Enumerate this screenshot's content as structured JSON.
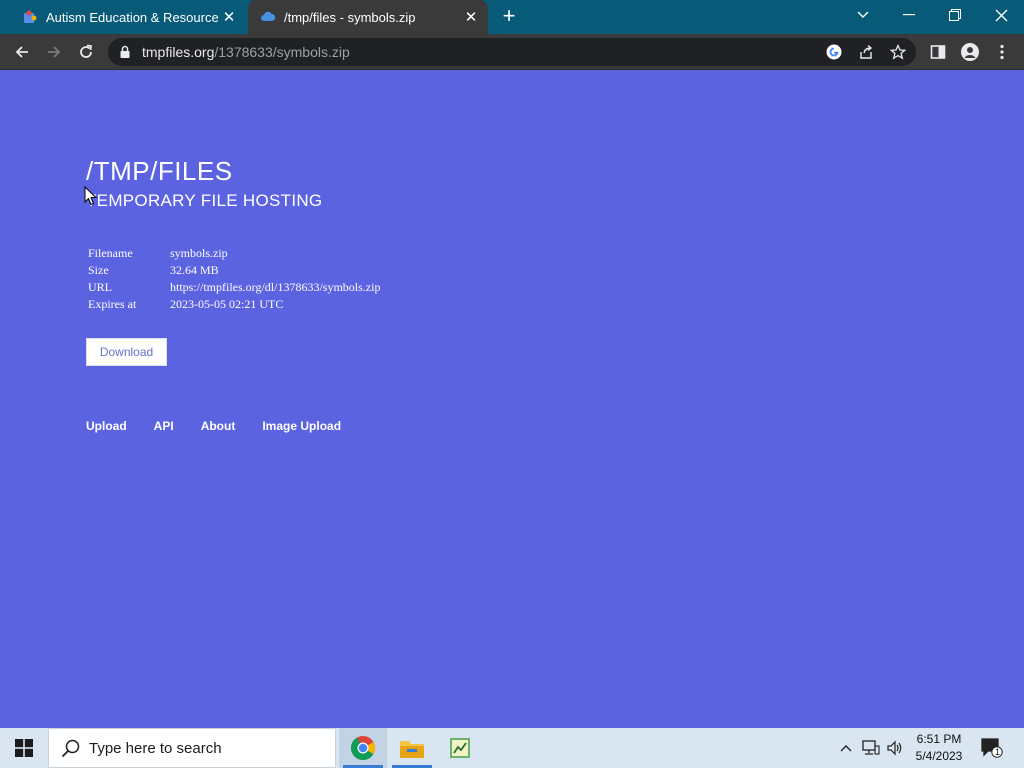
{
  "browser": {
    "tabs": [
      {
        "title": "Autism Education & Resources | A",
        "active": false
      },
      {
        "title": "/tmp/files - symbols.zip",
        "active": true
      }
    ],
    "address": {
      "host": "tmpfiles.org",
      "path": "/1378633/symbols.zip"
    }
  },
  "page": {
    "title": "/TMP/FILES",
    "subtitle": "TEMPORARY FILE HOSTING",
    "file_info": [
      {
        "label": "Filename",
        "value": "symbols.zip"
      },
      {
        "label": "Size",
        "value": "32.64 MB"
      },
      {
        "label": "URL",
        "value": "https://tmpfiles.org/dl/1378633/symbols.zip"
      },
      {
        "label": "Expires at",
        "value": "2023-05-05 02:21 UTC"
      }
    ],
    "download_label": "Download",
    "footer_links": [
      "Upload",
      "API",
      "About",
      "Image Upload"
    ]
  },
  "taskbar": {
    "search_placeholder": "Type here to search",
    "time": "6:51 PM",
    "date": "5/4/2023",
    "notification_count": "1"
  },
  "colors": {
    "page_bg": "#5b63e0",
    "tabstrip_bg": "#075a78",
    "toolbar_bg": "#3a3a3a",
    "taskbar_bg": "#d9e6f2"
  }
}
